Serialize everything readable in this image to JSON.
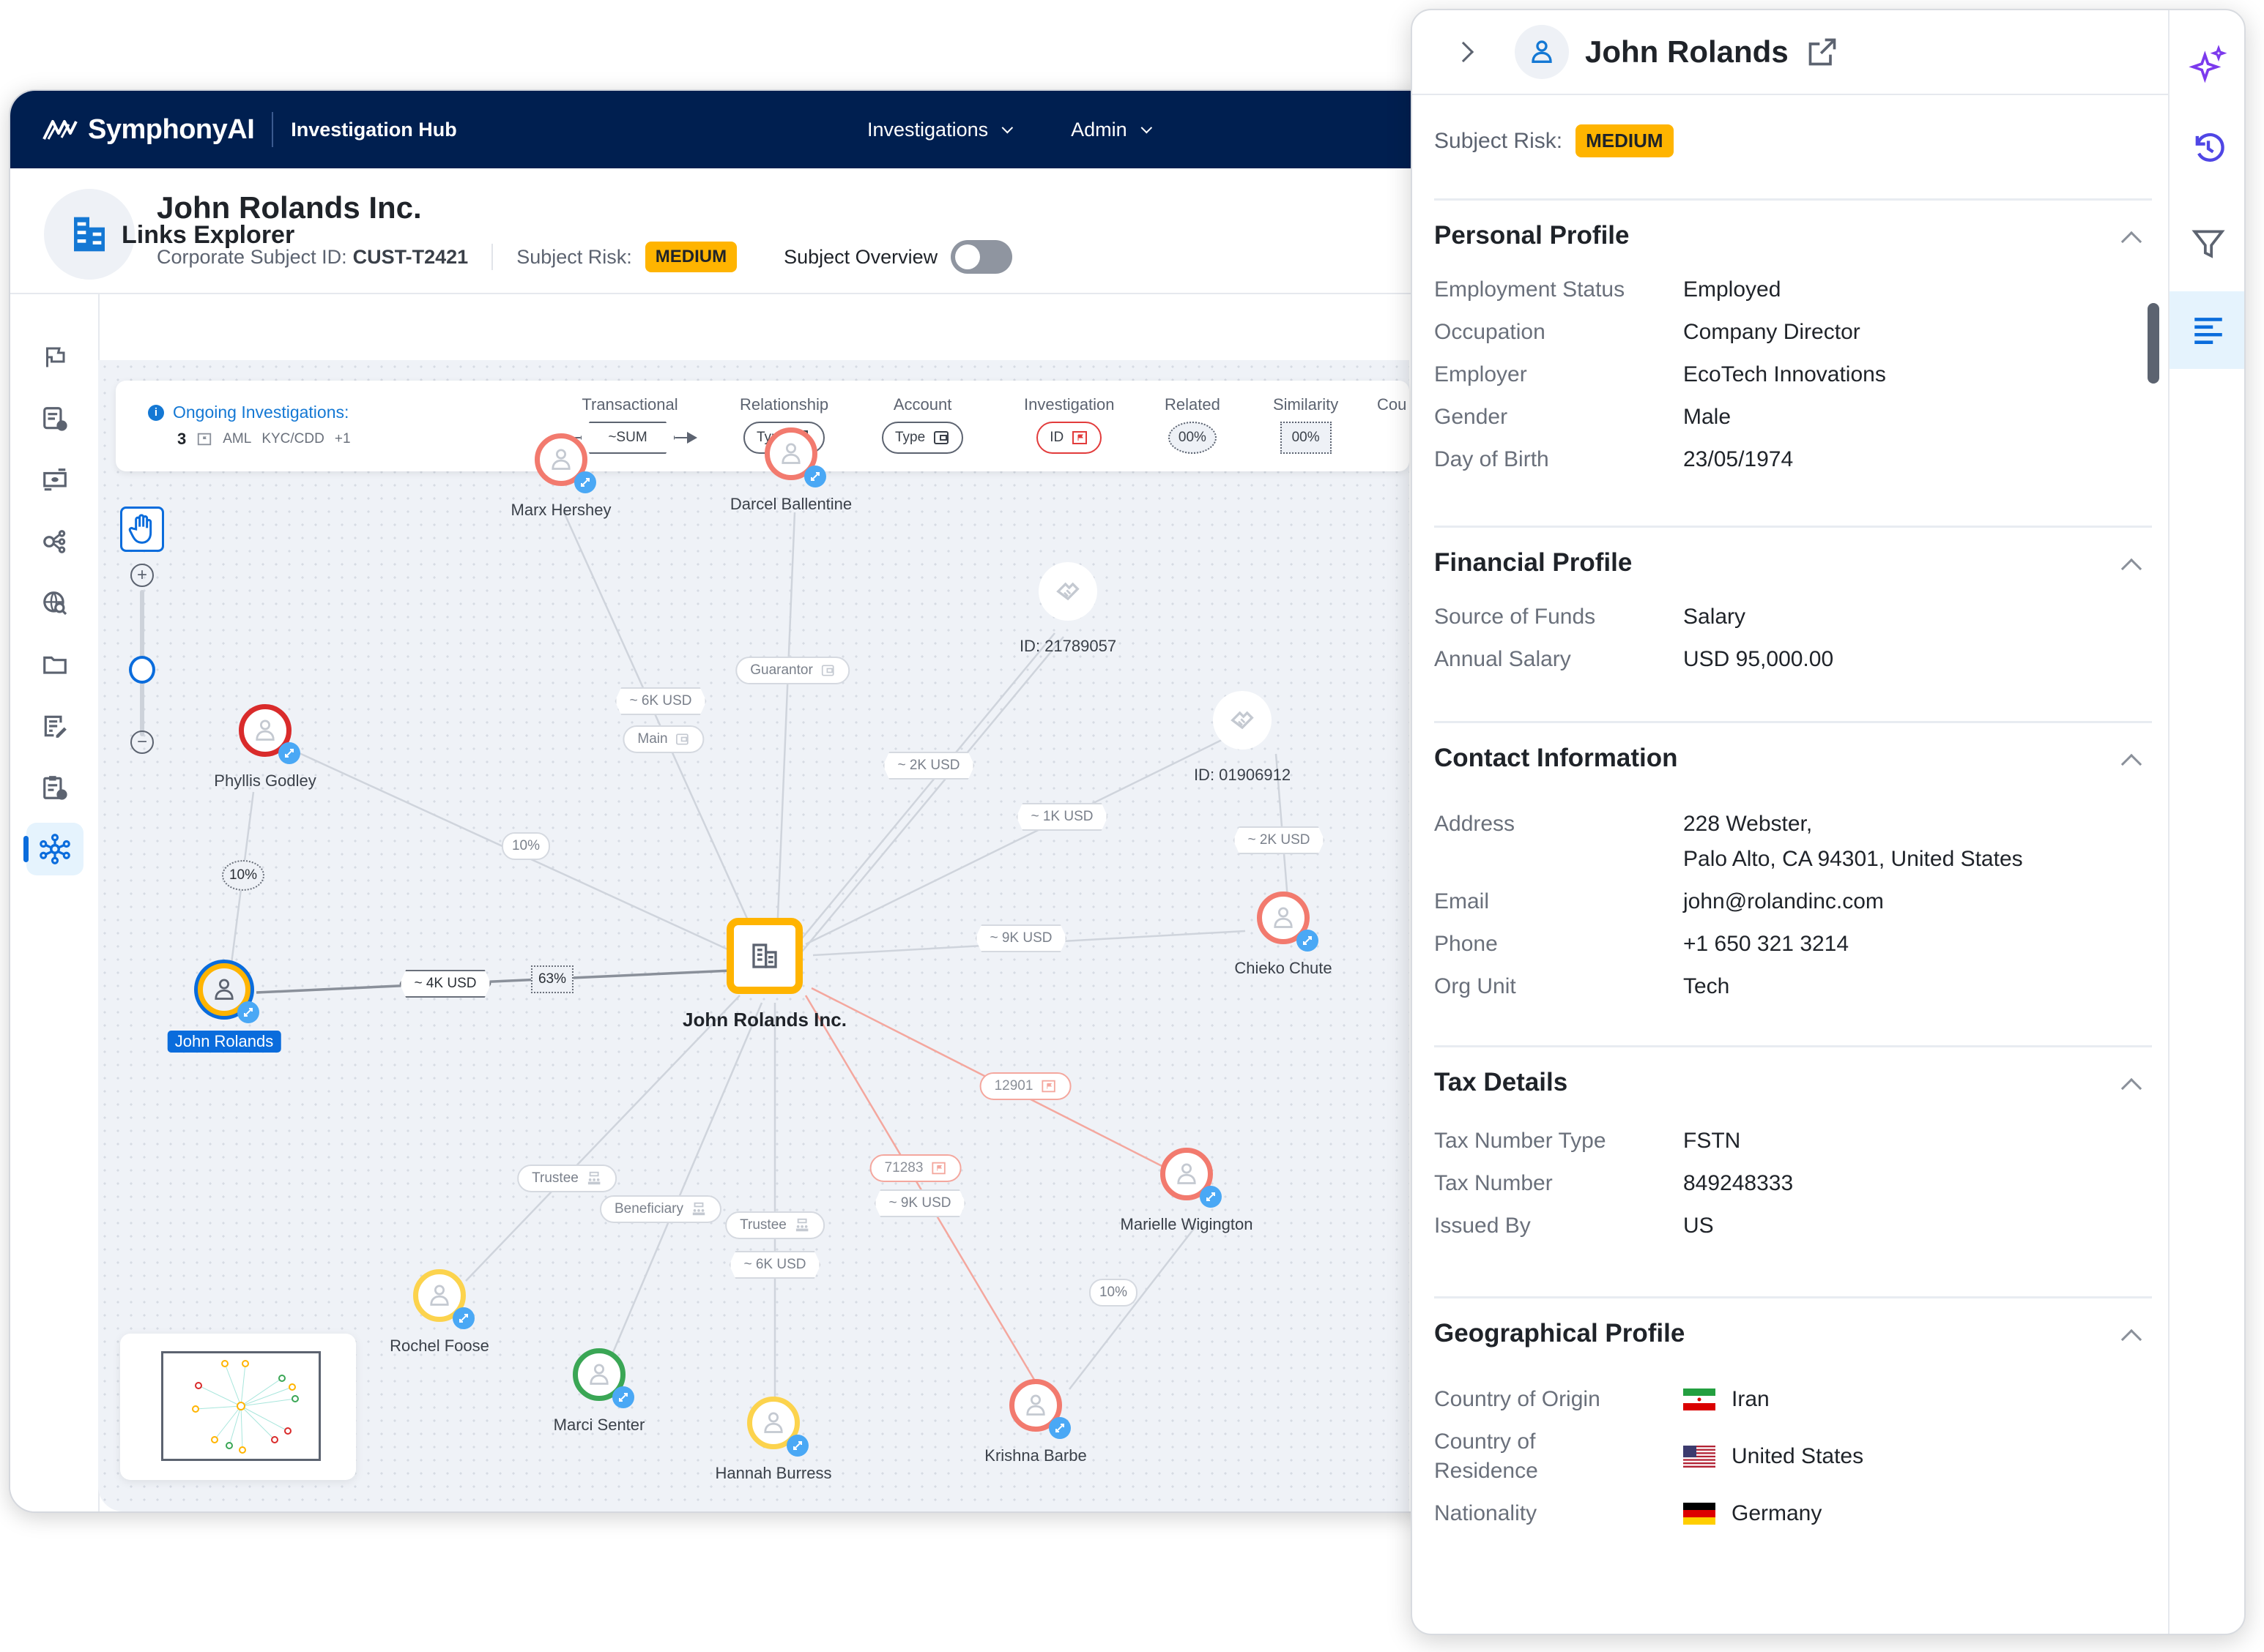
{
  "app": {
    "brand": "SymphonyAI",
    "product": "Investigation Hub",
    "nav": [
      {
        "label": "Investigations"
      },
      {
        "label": "Admin"
      }
    ]
  },
  "subject": {
    "name": "John Rolands Inc.",
    "id_label": "Corporate Subject ID:",
    "id_value": "CUST-T2421",
    "risk_label": "Subject Risk:",
    "risk_value": "MEDIUM",
    "overview_label": "Subject Overview",
    "overview_on": false
  },
  "left_rail": {
    "items": [
      {
        "icon": "flag-icon"
      },
      {
        "icon": "document-info-icon"
      },
      {
        "icon": "transactions-icon"
      },
      {
        "icon": "network-settings-icon"
      },
      {
        "icon": "web-search-icon"
      },
      {
        "icon": "folder-icon"
      },
      {
        "icon": "notes-edit-icon"
      },
      {
        "icon": "clipboard-clock-icon"
      },
      {
        "icon": "links-graph-icon",
        "active": true
      }
    ]
  },
  "explorer": {
    "title": "Links Explorer",
    "ongoing": {
      "label": "Ongoing Investigations:",
      "count": "3",
      "tags": [
        "AML",
        "KYC/CDD",
        "+1"
      ]
    },
    "legend": [
      {
        "label": "Transactional",
        "chip": "~SUM",
        "style": "hex"
      },
      {
        "label": "Relationship",
        "chip": "Type",
        "style": "pill",
        "icon": "group-icon"
      },
      {
        "label": "Account",
        "chip": "Type",
        "style": "pill",
        "icon": "wallet-icon"
      },
      {
        "label": "Investigation",
        "chip": "ID",
        "style": "pill-red",
        "icon": "folder-flag-icon"
      },
      {
        "label": "Related",
        "chip": "00%",
        "style": "dot-round"
      },
      {
        "label": "Similarity",
        "chip": "00%",
        "style": "dot-square"
      },
      {
        "label": "Cou",
        "chip": "",
        "style": "cut"
      }
    ],
    "zoom_level": 0.55,
    "nodes": [
      {
        "id": "center",
        "label": "John Rolands Inc.",
        "type": "company"
      },
      {
        "id": "john",
        "label": "John Rolands",
        "type": "person",
        "ring": "#ffb400",
        "selected": true
      },
      {
        "id": "phyllis",
        "label": "Phyllis Godley",
        "type": "person",
        "ring": "#d92b2b"
      },
      {
        "id": "marx",
        "label": "Marx Hershey",
        "type": "person",
        "ring": "#f27a6e"
      },
      {
        "id": "darcel",
        "label": "Darcel Ballentine",
        "type": "person",
        "ring": "#f27a6e"
      },
      {
        "id": "dev1",
        "label": "ID: 21789057",
        "type": "device"
      },
      {
        "id": "dev2",
        "label": "ID: 01906912",
        "type": "device"
      },
      {
        "id": "chieko",
        "label": "Chieko Chute",
        "type": "person",
        "ring": "#f27a6e"
      },
      {
        "id": "marielle",
        "label": "Marielle Wigington",
        "type": "person",
        "ring": "#f27a6e"
      },
      {
        "id": "krishna",
        "label": "Krishna Barbe",
        "type": "person",
        "ring": "#f27a6e"
      },
      {
        "id": "hannah",
        "label": "Hannah Burress",
        "type": "person",
        "ring": "#fcd34d"
      },
      {
        "id": "marci",
        "label": "Marci Senter",
        "type": "person",
        "ring": "#3aa655"
      },
      {
        "id": "rochel",
        "label": "Rochel Foose",
        "type": "person",
        "ring": "#fcd34d"
      }
    ],
    "edge_labels": [
      {
        "text": "~ 6K USD",
        "kind": "transaction"
      },
      {
        "text": "Main",
        "kind": "account"
      },
      {
        "text": "Guarantor",
        "kind": "account"
      },
      {
        "text": "~ 2K USD",
        "kind": "transaction"
      },
      {
        "text": "~ 1K USD",
        "kind": "transaction"
      },
      {
        "text": "~ 2K USD",
        "kind": "transaction"
      },
      {
        "text": "~ 9K USD",
        "kind": "transaction"
      },
      {
        "text": "10%",
        "kind": "related"
      },
      {
        "text": "10%",
        "kind": "related-dotted"
      },
      {
        "text": "~ 4K USD",
        "kind": "transaction-active"
      },
      {
        "text": "63%",
        "kind": "similarity"
      },
      {
        "text": "12901",
        "kind": "investigation"
      },
      {
        "text": "71283",
        "kind": "investigation"
      },
      {
        "text": "~ 9K USD",
        "kind": "transaction"
      },
      {
        "text": "Trustee",
        "kind": "relationship"
      },
      {
        "text": "Beneficiary",
        "kind": "relationship"
      },
      {
        "text": "Trustee",
        "kind": "relationship"
      },
      {
        "text": "~ 6K USD",
        "kind": "transaction"
      },
      {
        "text": "10%",
        "kind": "related"
      }
    ]
  },
  "panel": {
    "name": "John Rolands",
    "risk_label": "Subject Risk:",
    "risk_value": "MEDIUM",
    "sections": {
      "personal": {
        "title": "Personal Profile",
        "rows": [
          {
            "k": "Employment Status",
            "v": "Employed"
          },
          {
            "k": "Occupation",
            "v": "Company Director"
          },
          {
            "k": "Employer",
            "v": "EcoTech Innovations"
          },
          {
            "k": "Gender",
            "v": "Male"
          },
          {
            "k": "Day of Birth",
            "v": "23/05/1974"
          }
        ]
      },
      "financial": {
        "title": "Financial Profile",
        "rows": [
          {
            "k": "Source of Funds",
            "v": "Salary"
          },
          {
            "k": "Annual Salary",
            "v": "USD 95,000.00"
          }
        ]
      },
      "contact": {
        "title": "Contact Information",
        "address_label": "Address",
        "address_line1": "228 Webster,",
        "address_line2": "Palo Alto, CA 94301, United States",
        "rows": [
          {
            "k": "Email",
            "v": "john@rolandinc.com"
          },
          {
            "k": "Phone",
            "v": "+1 650 321 3214"
          },
          {
            "k": "Org Unit",
            "v": "Tech"
          }
        ]
      },
      "tax": {
        "title": "Tax Details",
        "rows": [
          {
            "k": "Tax Number Type",
            "v": "FSTN"
          },
          {
            "k": "Tax Number",
            "v": "849248333"
          },
          {
            "k": "Issued By",
            "v": "US"
          }
        ]
      },
      "geo": {
        "title": "Geographical Profile",
        "rows": [
          {
            "k": "Country of Origin",
            "v": "Iran",
            "flag": "iran-flag-icon"
          },
          {
            "k": "Country of Residence",
            "v": "United States",
            "flag": "us-flag-icon"
          },
          {
            "k": "Nationality",
            "v": "Germany",
            "flag": "germany-flag-icon"
          }
        ]
      }
    },
    "rail": [
      {
        "icon": "ai-sparkle-icon"
      },
      {
        "icon": "history-icon"
      },
      {
        "icon": "filter-icon"
      },
      {
        "icon": "details-list-icon",
        "active": true
      }
    ]
  },
  "colors": {
    "brand_navy": "#001f50",
    "accent_blue": "#0a6cdc",
    "risk_medium": "#ffb400",
    "investigation_red": "#e23b3b",
    "ai_purple": "#7c3aed"
  }
}
